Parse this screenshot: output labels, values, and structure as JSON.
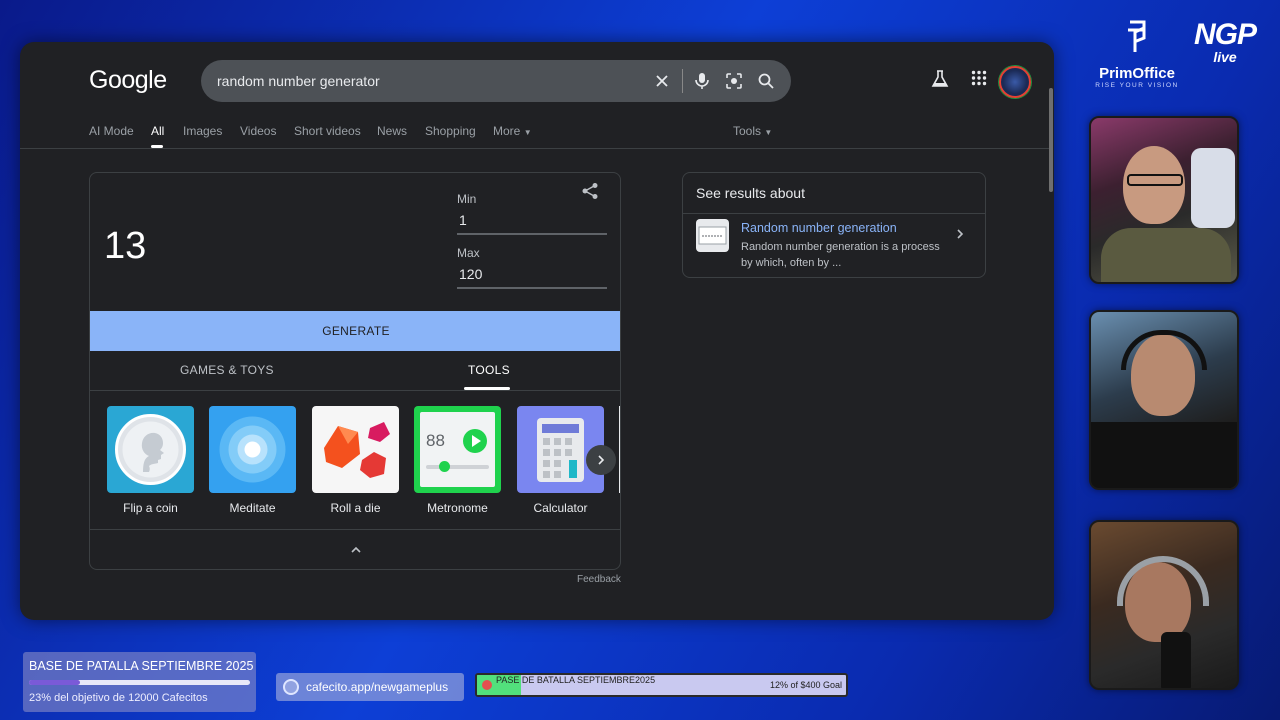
{
  "search": {
    "logo": "Google",
    "query": "random number generator"
  },
  "tabs": [
    "AI Mode",
    "All",
    "Images",
    "Videos",
    "Short videos",
    "News",
    "Shopping",
    "More"
  ],
  "tools_label": "Tools",
  "rng": {
    "result": "13",
    "min_label": "Min",
    "min_value": "1",
    "max_label": "Max",
    "max_value": "120",
    "generate_label": "GENERATE",
    "tab_games": "GAMES & TOYS",
    "tab_tools": "TOOLS",
    "tools": [
      "Flip a coin",
      "Meditate",
      "Roll a die",
      "Metronome",
      "Calculator"
    ],
    "metronome_bpm": "88",
    "feedback": "Feedback"
  },
  "knowledge": {
    "title": "See results about",
    "link": "Random number generation",
    "desc": "Random number generation is a process by which, often by ..."
  },
  "overlay": {
    "brand_name": "PrimOffice",
    "brand_sub": "RISE YOUR VISION",
    "ngp": "NGP",
    "live": "live",
    "goal_title": "BASE DE PATALLA SEPTIEMBRE 2025",
    "goal_sub": "23% del objetivo de 12000 Cafecitos",
    "goal_progress": 0.23,
    "cafecito": "cafecito.app/newgameplus",
    "pase_title": "PASE DE BATALLA SEPTIEMBRE2025",
    "pase_goal": "12% of $400 Goal",
    "pase_progress": 0.12
  },
  "colors": {
    "accent": "#8ab4f8",
    "bg": "#202124"
  }
}
